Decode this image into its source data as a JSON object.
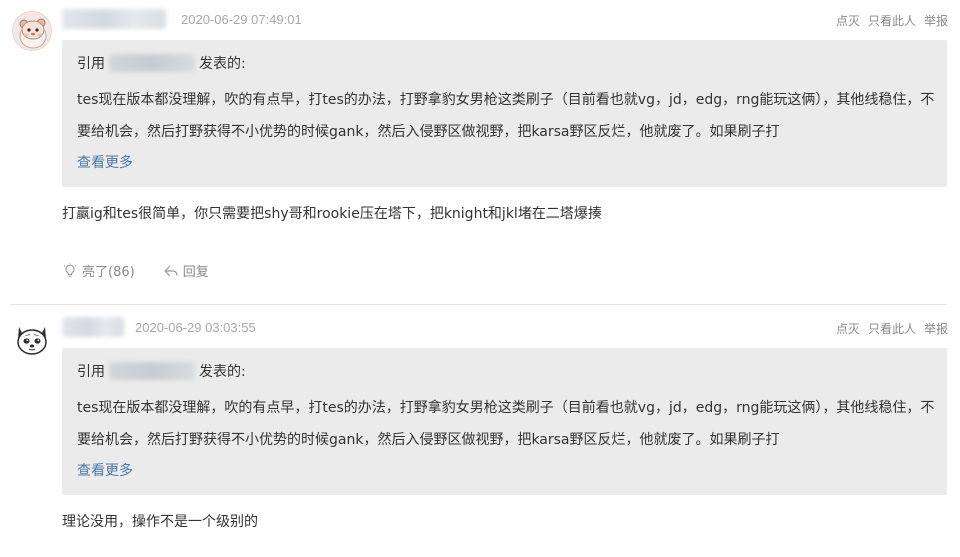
{
  "comments": [
    {
      "timestamp": "2020-06-29 07:49:01",
      "actions": [
        "点灭",
        "只看此人",
        "举报"
      ],
      "quote": {
        "prefix": "引用",
        "suffix": "发表的:",
        "body": "tes现在版本都没理解，吹的有点早，打tes的办法，打野拿豹女男枪这类刷子（目前看也就vg，jd，edg，rng能玩这俩），其他线稳住，不要给机会，然后打野获得不小优势的时候gank，然后入侵野区做视野，把karsa野区反烂，他就废了。如果刷子打",
        "more": "查看更多"
      },
      "reply": "打赢ig和tes很简单，你只需要把shy哥和rookie压在塔下，把knight和jkl堵在二塔爆揍",
      "like_label": "亮了(86)",
      "reply_label": "回复"
    },
    {
      "timestamp": "2020-06-29 03:03:55",
      "actions": [
        "点灭",
        "只看此人",
        "举报"
      ],
      "quote": {
        "prefix": "引用",
        "suffix": "发表的:",
        "body": "tes现在版本都没理解，吹的有点早，打tes的办法，打野拿豹女男枪这类刷子（目前看也就vg，jd，edg，rng能玩这俩），其他线稳住，不要给机会，然后打野获得不小优势的时候gank，然后入侵野区做视野，把karsa野区反烂，他就废了。如果刷子打",
        "more": "查看更多"
      },
      "reply": "理论没用，操作不是一个级别的"
    }
  ]
}
